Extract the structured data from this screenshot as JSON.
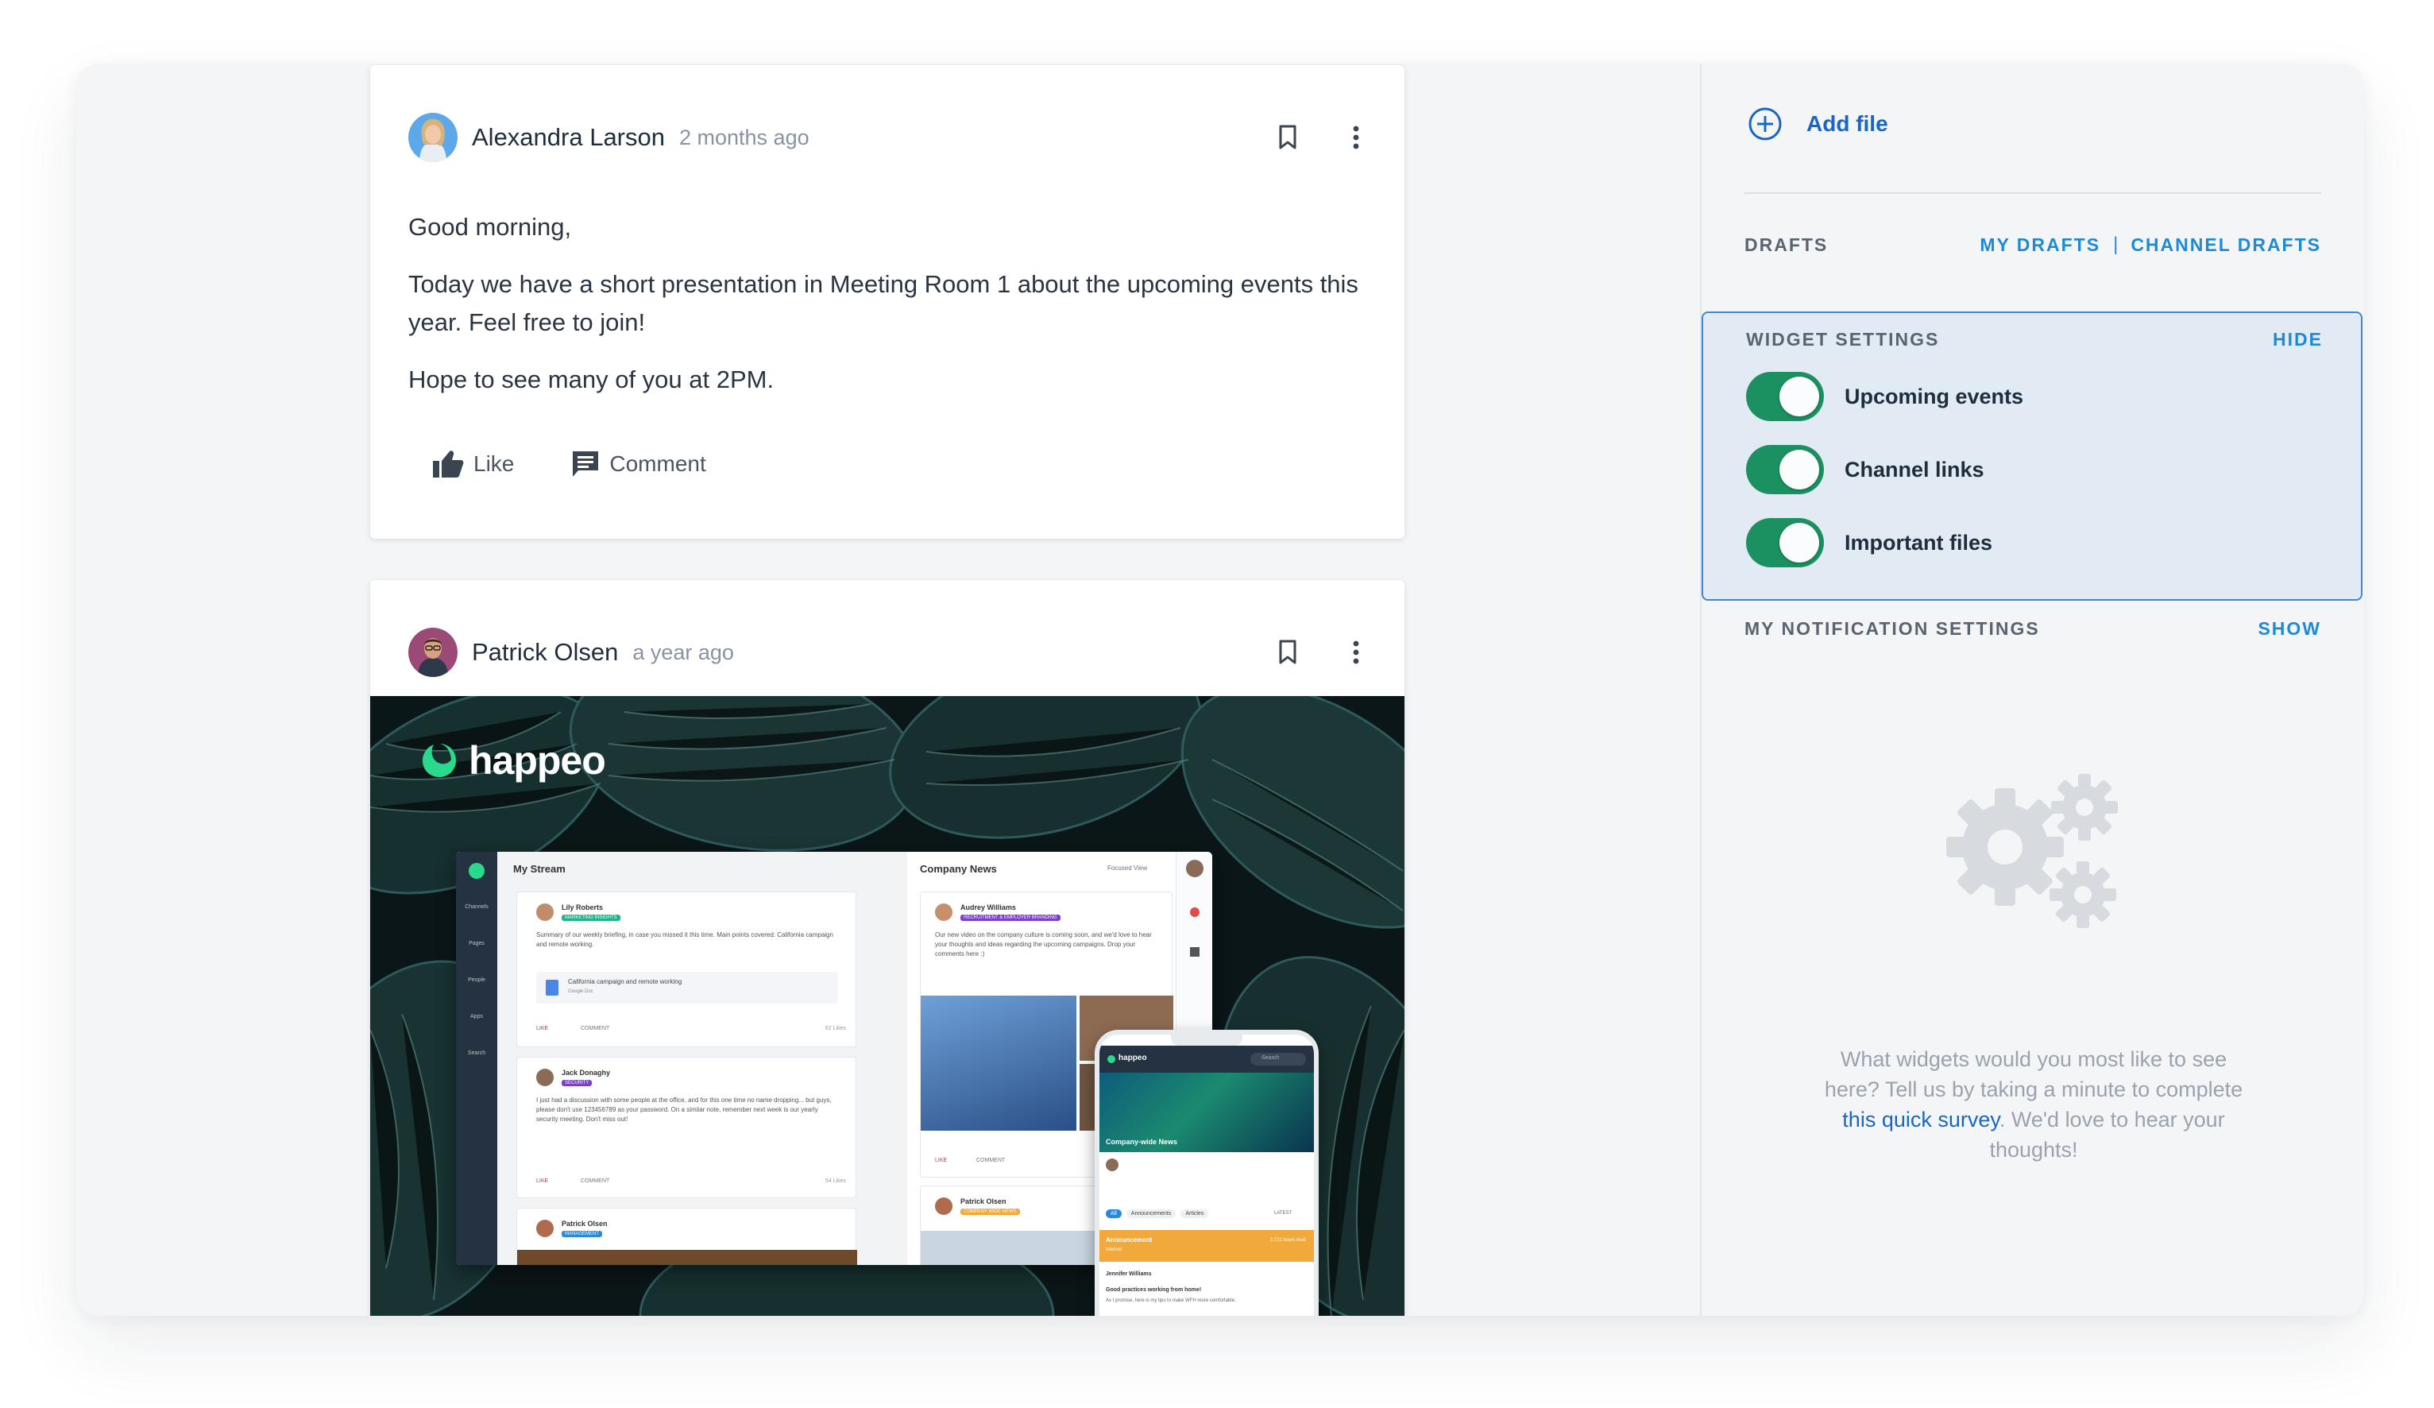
{
  "posts": [
    {
      "author": "Alexandra Larson",
      "time": "2 months ago",
      "paragraphs": [
        "Good morning,",
        "Today we have a short presentation in Meeting Room 1 about the upcoming events this year. Feel free to join!",
        "Hope to see many of you at 2PM."
      ],
      "like_label": "Like",
      "comment_label": "Comment"
    },
    {
      "author": "Patrick Olsen",
      "time": "a year ago",
      "image": {
        "logo_text": "happeo",
        "desktop": {
          "my_stream": "My Stream",
          "company_news": "Company News",
          "focused_view": "Focused View",
          "nav_items": [
            "Channels",
            "Pages",
            "People",
            "Apps",
            "Search"
          ],
          "stream_posts": [
            {
              "author": "Lily Roberts",
              "time": "3 hrs ago",
              "tag": "MARKETING INSIGHTS",
              "text": "Summary of our weekly briefing, in case you missed it this time. Main points covered: California campaign and remote working.",
              "file": "California campaign and remote working",
              "file_source": "Google Doc",
              "likes": "62 Likes"
            },
            {
              "author": "Jack Donaghy",
              "time": "3 hrs ago",
              "tag": "SECURITY",
              "text": "I just had a discussion with some people at the office, and for this one time no name dropping... but guys, please don't use 123456789 as your password. On a similar note, remember next week is our yearly security meeting. Don't miss out!",
              "likes": "54 Likes"
            },
            {
              "author": "Patrick Olsen",
              "time": "3 hrs ago",
              "tag": "MANAGEMENT"
            }
          ],
          "news_posts": [
            {
              "author": "Audrey Williams",
              "time": "3 hrs ago",
              "tag": "RECRUITMENT & EMPLOYER BRANDING",
              "text": "Our new video on the company culture is coming soon, and we'd love to hear your thoughts and ideas regarding the upcoming campaigns. Drop your comments here :)"
            },
            {
              "author": "Patrick Olsen",
              "time": "3 hrs ago",
              "tag": "COMPANY WIDE NEWS"
            }
          ],
          "like": "LIKE",
          "comment": "COMMENT"
        },
        "phone": {
          "logo": "happeo",
          "search": "Search",
          "banner_title": "Company-wide News",
          "tabs": [
            "All",
            "Announcements",
            "Articles"
          ],
          "latest": "LATEST",
          "announcement": "Announcement",
          "announcement_sub": "Internal",
          "announcement_stat": "2,721 hours read",
          "post_author": "Jennifer Williams",
          "post_title": "Good practices working from home!",
          "post_text": "As I promise, here is my tips to make WFH more comfortable."
        }
      }
    }
  ],
  "sidebar": {
    "add_file": "Add file",
    "drafts": {
      "title": "DRAFTS",
      "my_drafts": "MY DRAFTS",
      "separator": "|",
      "channel_drafts": "CHANNEL DRAFTS"
    },
    "widget_settings": {
      "title": "WIDGET SETTINGS",
      "hide": "HIDE",
      "toggles": [
        {
          "label": "Upcoming events",
          "on": true
        },
        {
          "label": "Channel links",
          "on": true
        },
        {
          "label": "Important files",
          "on": true
        }
      ]
    },
    "notifications": {
      "title": "MY NOTIFICATION SETTINGS",
      "show": "SHOW"
    },
    "empty_state": {
      "text_before": "What widgets would you most like to see here? Tell us by taking a minute to complete ",
      "link": "this quick survey",
      "text_after": ". We'd love to hear your thoughts!"
    }
  },
  "colors": {
    "accent": "#1a66c0",
    "link": "#1e8ad6",
    "toggle_on": "#1b9060",
    "panel_bg": "#e2eaf3",
    "panel_border": "#3f87d0"
  }
}
